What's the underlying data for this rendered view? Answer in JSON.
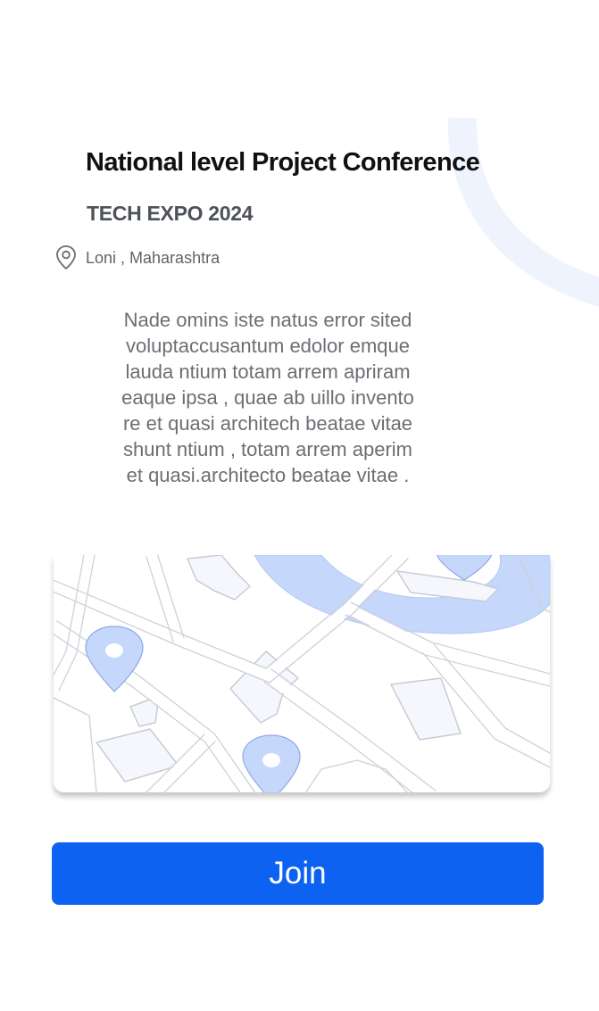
{
  "event": {
    "title": "National level Project Conference",
    "subtitle": "TECH EXPO 2024",
    "location": "Loni , Maharashtra",
    "description": "Nade omins iste natus error sited\nvoluptaccusantum edolor emque\nlauda ntium totam arrem apriram\neaque ipsa , quae ab uillo invento\nre et quasi architech beatae vitae\nshunt ntium , totam arrem aperim\net quasi.architecto beatae vitae ."
  },
  "actions": {
    "join_label": "Join"
  },
  "icons": {
    "location": "location-pin-icon",
    "map_marker": "map-marker-icon"
  },
  "colors": {
    "primary": "#0d62f2",
    "accent_light": "#c5d7fb",
    "deco_arc": "#eef3fd",
    "title": "#111111",
    "subtitle": "#4d5158",
    "body_text": "#6b6e73"
  }
}
